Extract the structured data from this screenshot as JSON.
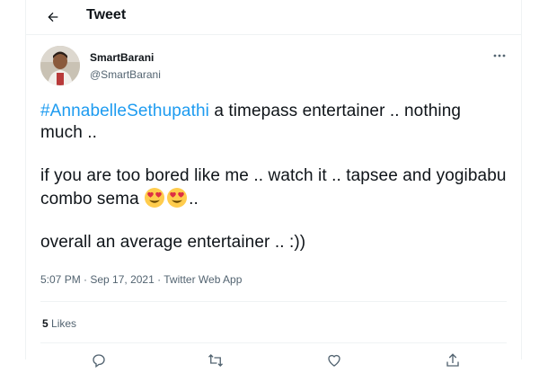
{
  "header": {
    "title": "Tweet"
  },
  "author": {
    "name": "SmartBarani",
    "handle": "@SmartBarani"
  },
  "tweet": {
    "hashtag": "#AnnabelleSethupathi",
    "line1_rest": " a timepass entertainer .. nothing much ..",
    "line2": "if you are too bored like me .. watch it .. tapsee and yogibabu combo sema ",
    "line2_end": "..",
    "line3": "overall an average entertainer .. :))",
    "emoji": "heart-eyes-face"
  },
  "meta": {
    "time": "5:07 PM",
    "separator": " · ",
    "date": "Sep 17, 2021",
    "source": "Twitter Web App"
  },
  "stats": {
    "likes_count": "5",
    "likes_label": "Likes"
  },
  "colors": {
    "accent": "#1d9bf0",
    "text": "#0f1419",
    "secondary": "#536471",
    "border": "#eff3f4"
  }
}
